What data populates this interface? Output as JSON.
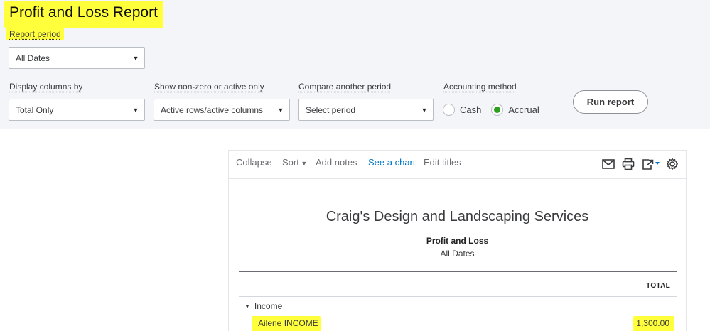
{
  "header": {
    "title": "Profit and Loss Report",
    "report_period_label": "Report period",
    "report_period_value": "All Dates"
  },
  "filters": {
    "display_columns": {
      "label": "Display columns by",
      "value": "Total Only"
    },
    "nonzero": {
      "label": "Show non-zero or active only",
      "value": "Active rows/active columns"
    },
    "compare": {
      "label": "Compare another period",
      "value": "Select period"
    },
    "accounting": {
      "label": "Accounting method",
      "options": [
        {
          "label": "Cash",
          "selected": false
        },
        {
          "label": "Accrual",
          "selected": true
        }
      ]
    },
    "run_label": "Run report"
  },
  "toolbar": {
    "collapse": "Collapse",
    "sort": "Sort",
    "add_notes": "Add notes",
    "see_chart": "See a chart",
    "edit_titles": "Edit titles",
    "icons": [
      "mail-icon",
      "print-icon",
      "export-icon",
      "settings-gear-icon"
    ]
  },
  "report": {
    "company": "Craig's Design and Landscaping Services",
    "name": "Profit and Loss",
    "period": "All Dates",
    "column_header": "TOTAL",
    "sections": [
      {
        "label": "Income",
        "rows": [
          {
            "account": "Ailene INCOME",
            "total": "1,300.00"
          }
        ]
      }
    ]
  },
  "colors": {
    "highlight": "#ffff3b",
    "panel_bg": "#f4f5f8",
    "link_blue": "#0077c5",
    "accent_green": "#2ca01c"
  }
}
